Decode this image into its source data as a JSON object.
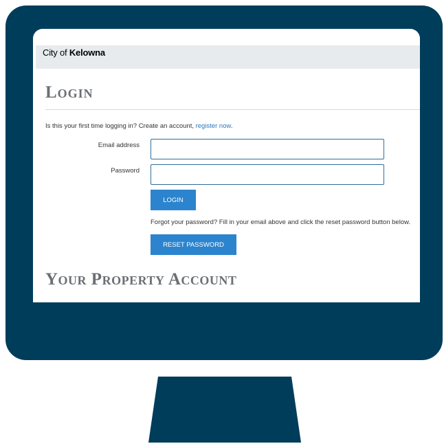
{
  "header": {
    "logo_light": "City of ",
    "logo_bold": "Kelowna"
  },
  "login": {
    "title": "Login",
    "intro_text": "Is this your first time logging in? Create an account, ",
    "register_link": "register now",
    "intro_end": ".",
    "email_label": "Email address",
    "email_value": "",
    "password_label": "Password",
    "password_value": "",
    "login_button": "LOGIN",
    "forgot_text": "Forgot your password? Fill in your email above and click the reset password button below.",
    "reset_button": "RESET PASSWORD"
  },
  "property": {
    "title": "Your Property Account"
  },
  "colors": {
    "frame": "#003d5b",
    "accent": "#2b84cd",
    "link": "#2b76b9",
    "title": "#6b6f73"
  }
}
